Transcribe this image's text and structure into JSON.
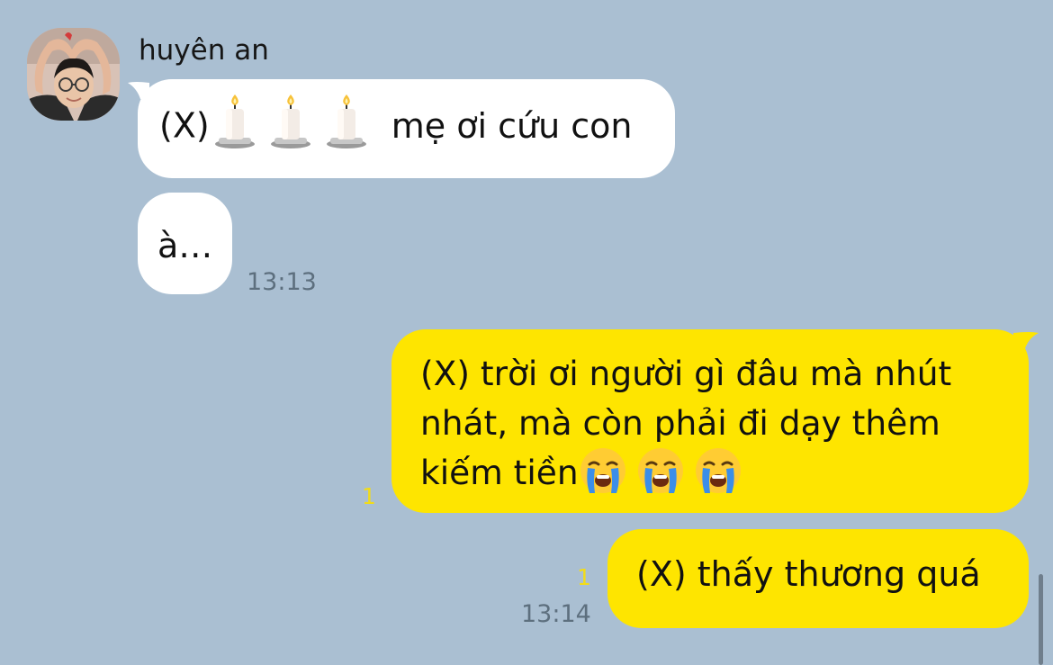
{
  "sender": {
    "name": "huyên an",
    "avatar_icon": "profile-photo-heart-hands"
  },
  "messages": [
    {
      "direction": "incoming",
      "segments": [
        "(X)",
        "candle-emoji",
        "candle-emoji",
        "candle-emoji",
        "mẹ ơi cứu con"
      ],
      "text_prefix": "(X)",
      "text_suffix": "mẹ ơi cứu con"
    },
    {
      "direction": "incoming",
      "text": "à…",
      "time": "13:13"
    },
    {
      "direction": "outgoing",
      "line1": "(X) trời ơi người gì đâu mà nhút",
      "line2": "nhát, mà còn phải đi dạy thêm",
      "line3": "kiếm tiền",
      "trailing_emoji": [
        "loudly-crying-face",
        "loudly-crying-face",
        "loudly-crying-face"
      ],
      "unread_count": "1"
    },
    {
      "direction": "outgoing",
      "text": "(X) thấy thương quá",
      "unread_count": "1",
      "time": "13:14"
    }
  ],
  "colors": {
    "background": "#aabfd2",
    "incoming_bubble": "#ffffff",
    "outgoing_bubble": "#fee500",
    "unread_count": "#f2dc18",
    "timestamp": "#5d6f7e"
  }
}
